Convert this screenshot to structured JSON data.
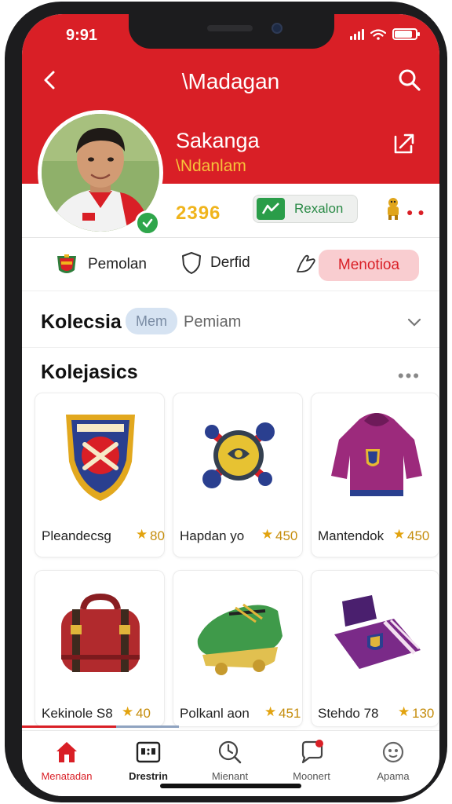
{
  "status": {
    "time": "9:91"
  },
  "nav": {
    "title": "\\Madagan"
  },
  "profile": {
    "name": "Sakanga",
    "subtitle": "\\Ndanlam",
    "points": "2396",
    "rank_label": "Rexalon"
  },
  "filters": [
    {
      "label": "Pemolan",
      "icon": "club-crest-icon"
    },
    {
      "label": "Derfid",
      "icon": "shield-icon"
    },
    {
      "label": "",
      "icon": "hand-icon"
    },
    {
      "label": "Menotioa",
      "icon": "",
      "active": true
    }
  ],
  "collection": {
    "title": "Kolecsia",
    "chip": "Mem",
    "subtitle": "Pemiam"
  },
  "section": {
    "title": "Kolejasics"
  },
  "items": [
    {
      "name": "Pleandecsg",
      "price": "80",
      "art": "crest-shield"
    },
    {
      "name": "Hapdan yo",
      "price": "450",
      "art": "spinner-gadget"
    },
    {
      "name": "Mantendok",
      "price": "450",
      "art": "purple-hoodie"
    },
    {
      "name": "Kekinole S8",
      "price": "40",
      "art": "red-bag"
    },
    {
      "name": "Polkanl aon",
      "price": "451",
      "art": "green-boot"
    },
    {
      "name": "Stehdo 78",
      "price": "130",
      "art": "purple-scarf"
    }
  ],
  "bottom_nav": [
    {
      "label": "Menatadan",
      "icon": "home-icon",
      "active": true
    },
    {
      "label": "Drestrin",
      "icon": "scoreboard-icon"
    },
    {
      "label": "Mienant",
      "icon": "clock-search-icon"
    },
    {
      "label": "Moonert",
      "icon": "chat-notification-icon"
    },
    {
      "label": "Apama",
      "icon": "settings-icon"
    }
  ],
  "colors": {
    "brand_red": "#d91f26",
    "gold": "#f0b41c",
    "green": "#2a9d49"
  }
}
